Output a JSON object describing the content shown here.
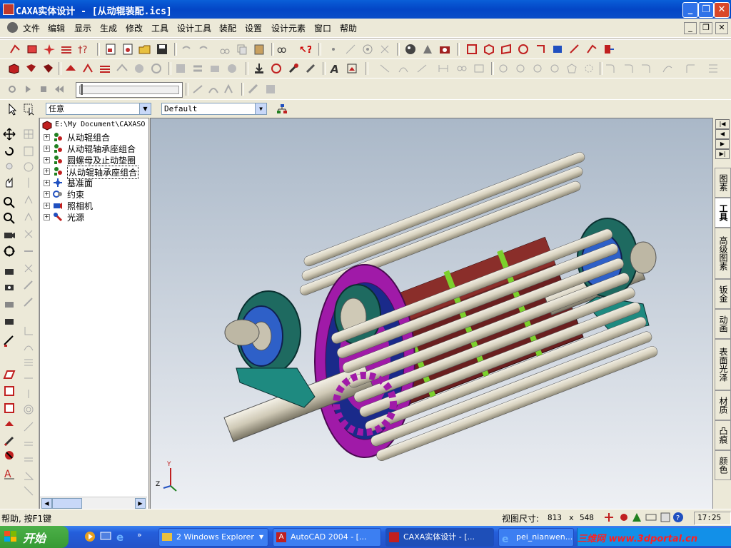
{
  "window": {
    "title": "CAXA实体设计 - [从动辊装配.ics]"
  },
  "menu": [
    "文件",
    "编辑",
    "显示",
    "生成",
    "修改",
    "工具",
    "设计工具",
    "装配",
    "设置",
    "设计元素",
    "窗口",
    "帮助"
  ],
  "toolbar": {
    "selection_filter": "任意",
    "style_combo": "Default"
  },
  "tree": {
    "root": "E:\\My Document\\CAXASO",
    "items": [
      "从动辊组合",
      "从动辊轴承座组合",
      "圆螺母及止动垫圈",
      "从动辊轴承座组合",
      "基准面",
      "约束",
      "照相机",
      "光源"
    ]
  },
  "right_tabs": [
    "图素",
    "工具",
    "高级图素",
    "钣金",
    "动画",
    "表面光泽",
    "材质",
    "凸痕",
    "颜色"
  ],
  "axis_labels": {
    "y": "Y",
    "z": "Z"
  },
  "status": {
    "help": "帮助, 按F1键",
    "view_size_label": "视图尺寸:",
    "view_w": "813",
    "x": "x",
    "view_h": "548"
  },
  "taskbar": {
    "start": "开始",
    "tasks": [
      "2 Windows Explorer",
      "AutoCAD 2004 - [...",
      "CAXA实体设计 - [...",
      "pei_nianwen..."
    ],
    "clock": "17:25",
    "watermark": "三维网 www.3dportal.cn"
  },
  "colors": {
    "accent": "#0a5fd8",
    "viewport_bg": "#aab8c8"
  }
}
